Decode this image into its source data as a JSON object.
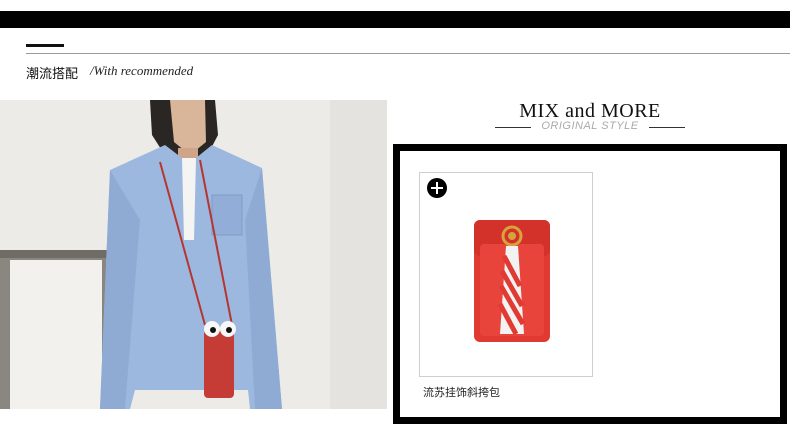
{
  "section": {
    "title": "潮流搭配",
    "subtitle": "/With recommended"
  },
  "mix": {
    "title": "MIX and MORE",
    "subtitle": "ORIGINAL STYLE"
  },
  "product": {
    "name": "流苏挂饰斜挎包",
    "add_icon": "plus-circle-icon",
    "color": "#e03a32"
  },
  "colors": {
    "topbar": "#000000",
    "frame": "#000000",
    "shirt": "#9bb6dd",
    "bag": "#c53b35"
  }
}
